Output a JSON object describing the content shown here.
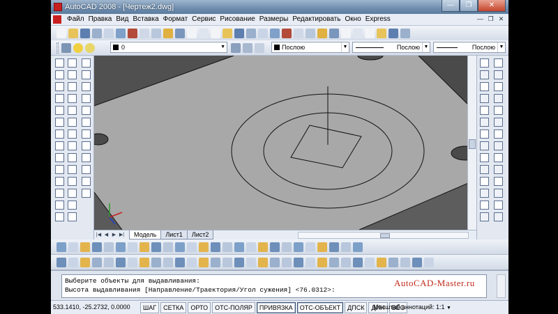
{
  "window": {
    "title": "AutoCAD 2008 - [Чертеж2.dwg]",
    "minimize": "—",
    "maximize": "❐",
    "close": "✕"
  },
  "menu": {
    "items": [
      {
        "label": "Файл"
      },
      {
        "label": "Правка"
      },
      {
        "label": "Вид"
      },
      {
        "label": "Вставка"
      },
      {
        "label": "Формат"
      },
      {
        "label": "Сервис"
      },
      {
        "label": "Рисование"
      },
      {
        "label": "Размеры"
      },
      {
        "label": "Редактировать"
      },
      {
        "label": "Окно"
      },
      {
        "label": "Express"
      }
    ],
    "mdi": [
      "—",
      "❐",
      "✕"
    ]
  },
  "layers": {
    "current_layer": "0"
  },
  "properties": {
    "color": "Послою",
    "linetype": "Послою",
    "lineweight": "Послою"
  },
  "layout_tabs": {
    "tabs": [
      "Модель",
      "Лист1",
      "Лист2"
    ],
    "active": "Модель"
  },
  "command_line": {
    "line1": "Выберите объекты для выдавливания:",
    "line2": "Высота выдавливания [Направление/Траектория/Угол сужения] <76.0312>:"
  },
  "watermark": "AutoCAD-Master.ru",
  "status": {
    "coordinates": "533.1410, -25.2732, 0.0000",
    "buttons": [
      "ШАГ",
      "СЕТКА",
      "ОРТО",
      "ОТС-ПОЛЯР",
      "ПРИВЯЗКА",
      "ОТС-ОБЪЕКТ",
      "ДПСК",
      "ДИН",
      "ВЕС"
    ],
    "active_buttons": [
      "ПРИВЯЗКА",
      "ОТС-ОБЪЕКТ"
    ],
    "annotation_scale_label": "Масштаб аннотаций:",
    "annotation_scale_value": "1:1"
  },
  "colors": {
    "accent": "#6f8dae",
    "viewport_bg": "#4a4a4a",
    "plate_top": "#a6a6a6",
    "watermark": "#c02a1a"
  }
}
